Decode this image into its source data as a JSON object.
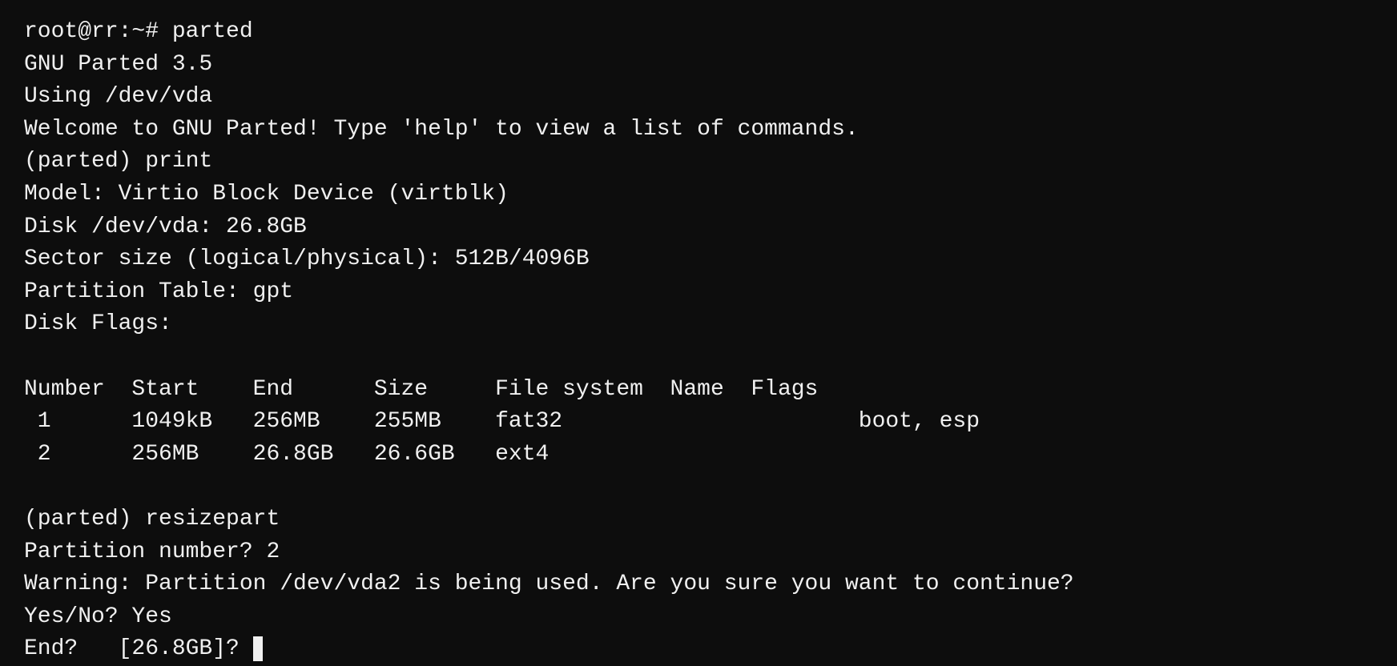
{
  "terminal": {
    "lines": [
      {
        "id": "line-prompt",
        "text": "root@rr:~# parted"
      },
      {
        "id": "line-version",
        "text": "GNU Parted 3.5"
      },
      {
        "id": "line-using",
        "text": "Using /dev/vda"
      },
      {
        "id": "line-welcome",
        "text": "Welcome to GNU Parted! Type 'help' to view a list of commands."
      },
      {
        "id": "line-print-cmd",
        "text": "(parted) print"
      },
      {
        "id": "line-model",
        "text": "Model: Virtio Block Device (virtblk)"
      },
      {
        "id": "line-disk",
        "text": "Disk /dev/vda: 26.8GB"
      },
      {
        "id": "line-sector",
        "text": "Sector size (logical/physical): 512B/4096B"
      },
      {
        "id": "line-partition-table",
        "text": "Partition Table: gpt"
      },
      {
        "id": "line-disk-flags",
        "text": "Disk Flags: "
      },
      {
        "id": "line-empty1",
        "text": ""
      },
      {
        "id": "line-table-header",
        "text": "Number  Start    End      Size     File system  Name  Flags"
      },
      {
        "id": "line-row1",
        "text": " 1      1049kB   256MB    255MB    fat32                      boot, esp"
      },
      {
        "id": "line-row2",
        "text": " 2      256MB    26.8GB   26.6GB   ext4"
      },
      {
        "id": "line-empty2",
        "text": ""
      },
      {
        "id": "line-resizepart-cmd",
        "text": "(parted) resizepart"
      },
      {
        "id": "line-partition-number",
        "text": "Partition number? 2"
      },
      {
        "id": "line-warning",
        "text": "Warning: Partition /dev/vda2 is being used. Are you sure you want to continue?"
      },
      {
        "id": "line-yesno",
        "text": "Yes/No? Yes"
      },
      {
        "id": "line-end",
        "text": "End?   [26.8GB]? ",
        "has_cursor": true
      }
    ]
  }
}
